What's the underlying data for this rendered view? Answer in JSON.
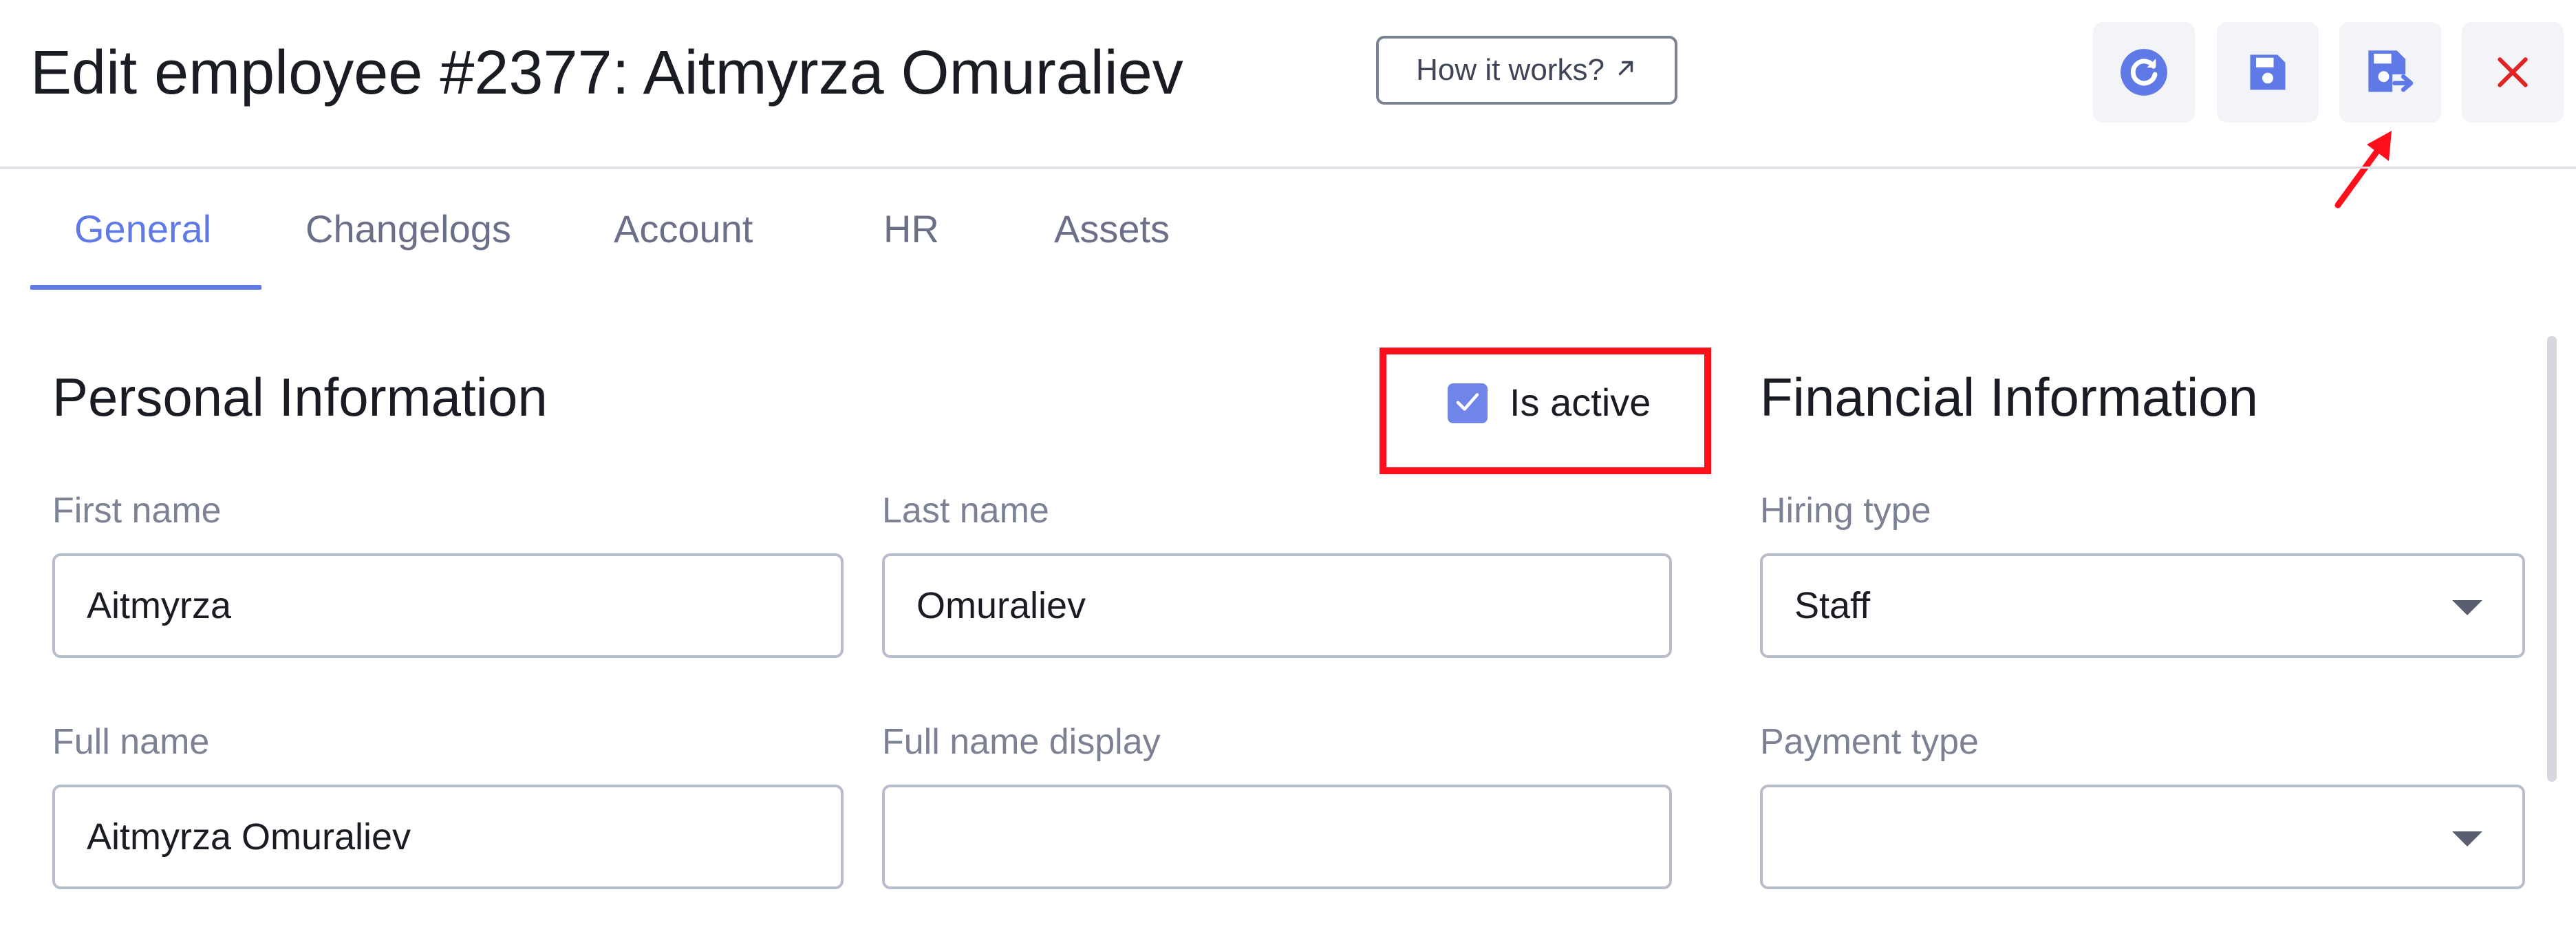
{
  "header": {
    "title": "Edit employee #2377: Aitmyrza Omuraliev",
    "how_it_works_label": "How it works?",
    "how_it_works_icon": "arrow-up-right-icon",
    "actions": [
      {
        "name": "refresh",
        "icon": "refresh-icon",
        "color": "#5f79e6"
      },
      {
        "name": "save",
        "icon": "save-icon",
        "color": "#5f79e6"
      },
      {
        "name": "save-and-close",
        "icon": "save-and-close-icon",
        "color": "#5f79e6"
      },
      {
        "name": "close",
        "icon": "close-icon",
        "color": "#e02424"
      }
    ]
  },
  "tabs": [
    {
      "label": "General",
      "active": true
    },
    {
      "label": "Changelogs",
      "active": false
    },
    {
      "label": "Account",
      "active": false
    },
    {
      "label": "HR",
      "active": false
    },
    {
      "label": "Assets",
      "active": false
    }
  ],
  "personal": {
    "title": "Personal Information",
    "is_active_label": "Is active",
    "is_active_checked": true,
    "first_name": {
      "label": "First name",
      "value": "Aitmyrza"
    },
    "last_name": {
      "label": "Last name",
      "value": "Omuraliev"
    },
    "full_name": {
      "label": "Full name",
      "value": "Aitmyrza Omuraliev"
    },
    "full_name_display": {
      "label": "Full name display",
      "value": ""
    }
  },
  "financial": {
    "title": "Financial Information",
    "hiring_type": {
      "label": "Hiring type",
      "value": "Staff"
    },
    "payment_type": {
      "label": "Payment type",
      "value": ""
    }
  },
  "colors": {
    "accent": "#5f79e6",
    "highlight": "#ff0f1c",
    "close": "#e02424"
  }
}
